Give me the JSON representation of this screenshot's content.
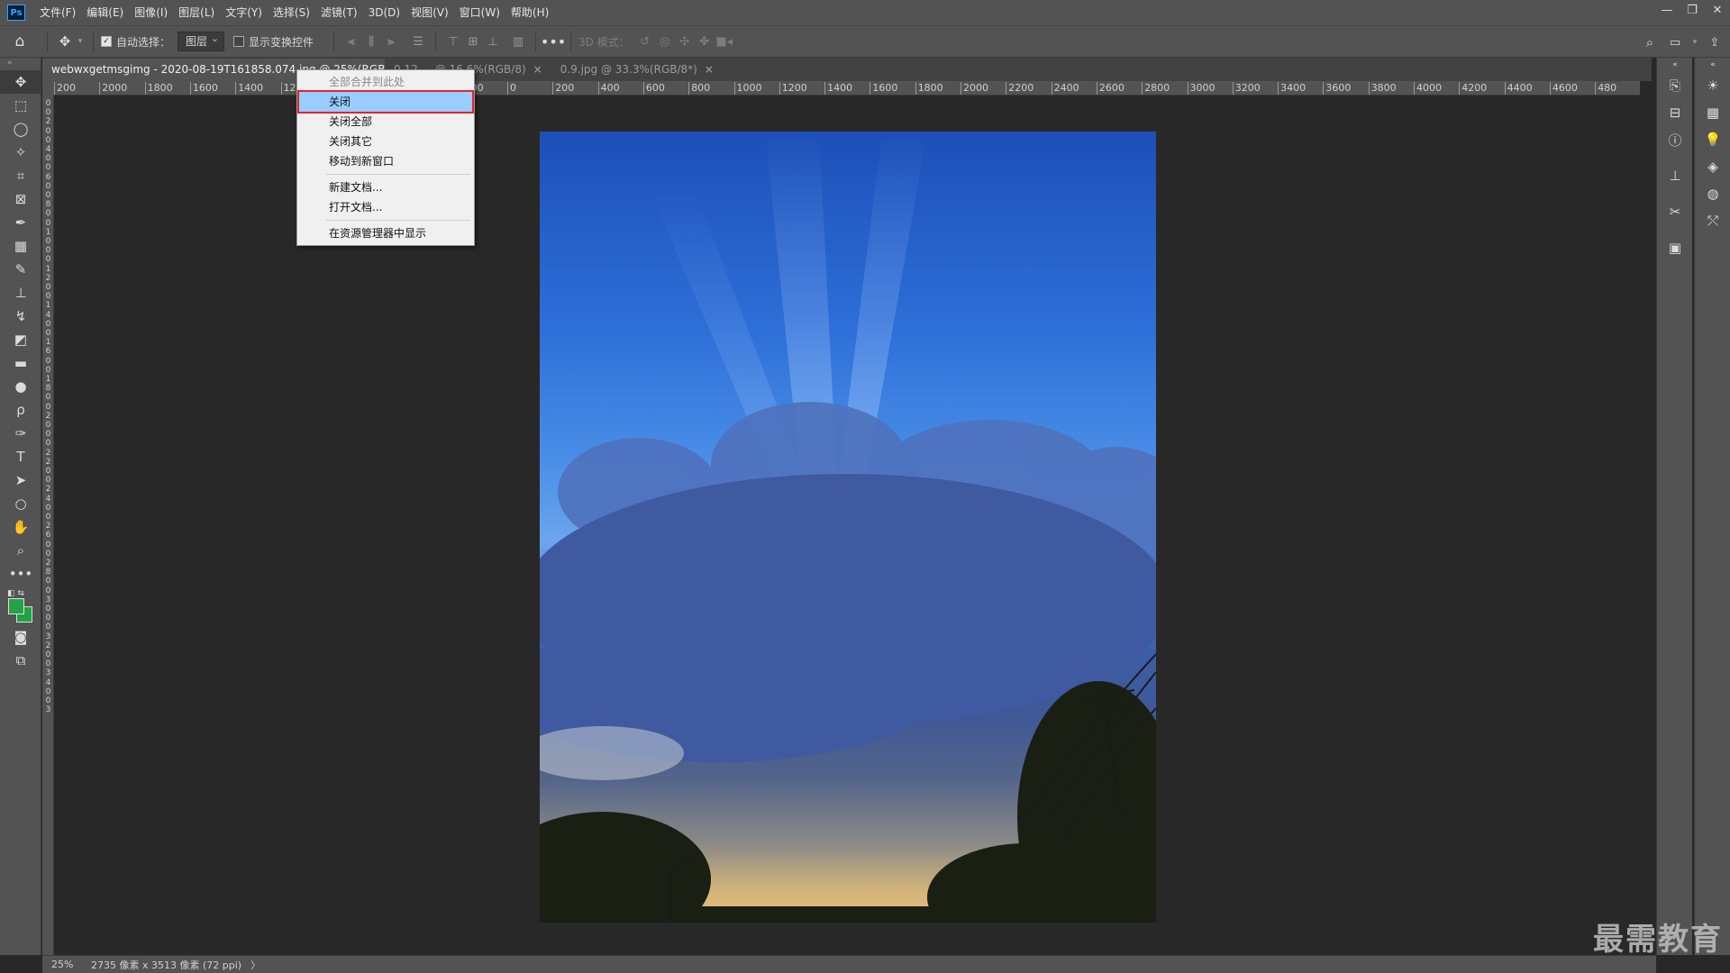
{
  "menubar": {
    "logo": "Ps",
    "items": [
      "文件(F)",
      "编辑(E)",
      "图像(I)",
      "图层(L)",
      "文字(Y)",
      "选择(S)",
      "滤镜(T)",
      "3D(D)",
      "视图(V)",
      "窗口(W)",
      "帮助(H)"
    ]
  },
  "options": {
    "auto_select_label": "自动选择：",
    "auto_select_value": "图层",
    "show_transform_label": "显示变换控件",
    "mode3d_label": "3D 模式："
  },
  "tabs": [
    {
      "label": "webwxgetmsgimg - 2020-08-19T161858.074.jpg @ 25%(RGB/8#)"
    },
    {
      "label": "0.12 ... @ 16.6%(RGB/8)"
    },
    {
      "label": "0.9.jpg @ 33.3%(RGB/8*)"
    }
  ],
  "hruler": [
    "200",
    "2000",
    "1800",
    "1600",
    "1400",
    "1200",
    "",
    "",
    "",
    "200",
    "0",
    "200",
    "400",
    "600",
    "800",
    "1000",
    "1200",
    "1400",
    "1600",
    "1800",
    "2000",
    "2200",
    "2400",
    "2600",
    "2800",
    "3000",
    "3200",
    "3400",
    "3600",
    "3800",
    "4000",
    "4200",
    "4400",
    "4600",
    "480"
  ],
  "vruler": [
    "0",
    "0",
    "2",
    "0",
    "0",
    "4",
    "0",
    "0",
    "6",
    "0",
    "0",
    "8",
    "0",
    "0",
    "1",
    "0",
    "0",
    "0",
    "1",
    "2",
    "0",
    "0",
    "1",
    "4",
    "0",
    "0",
    "1",
    "6",
    "0",
    "0",
    "1",
    "8",
    "0",
    "0",
    "2",
    "0",
    "0",
    "0",
    "2",
    "2",
    "0",
    "0",
    "2",
    "4",
    "0",
    "0",
    "2",
    "6",
    "0",
    "0",
    "2",
    "8",
    "0",
    "0",
    "3",
    "0",
    "0",
    "0",
    "3",
    "2",
    "0",
    "0",
    "3",
    "4",
    "0",
    "0",
    "3"
  ],
  "context_menu": {
    "items": [
      {
        "label": "全部合并到此处",
        "state": "disabled"
      },
      {
        "label": "关闭",
        "state": "highlight"
      },
      {
        "label": "关闭全部",
        "state": "normal"
      },
      {
        "label": "关闭其它",
        "state": "normal"
      },
      {
        "label": "移动到新窗口",
        "state": "normal"
      },
      {
        "label": "新建文档...",
        "state": "normal"
      },
      {
        "label": "打开文档...",
        "state": "normal"
      },
      {
        "label": "在资源管理器中显示",
        "state": "normal"
      }
    ]
  },
  "status": {
    "zoom": "25%",
    "doc_info": "2735 像素 x 3513 像素 (72 ppi)",
    "arrow": "〉"
  },
  "watermark": "最需教育",
  "colors": {
    "foreground": "#27a04a",
    "background": "#1fa340",
    "highlight_border": "#e0262b"
  }
}
